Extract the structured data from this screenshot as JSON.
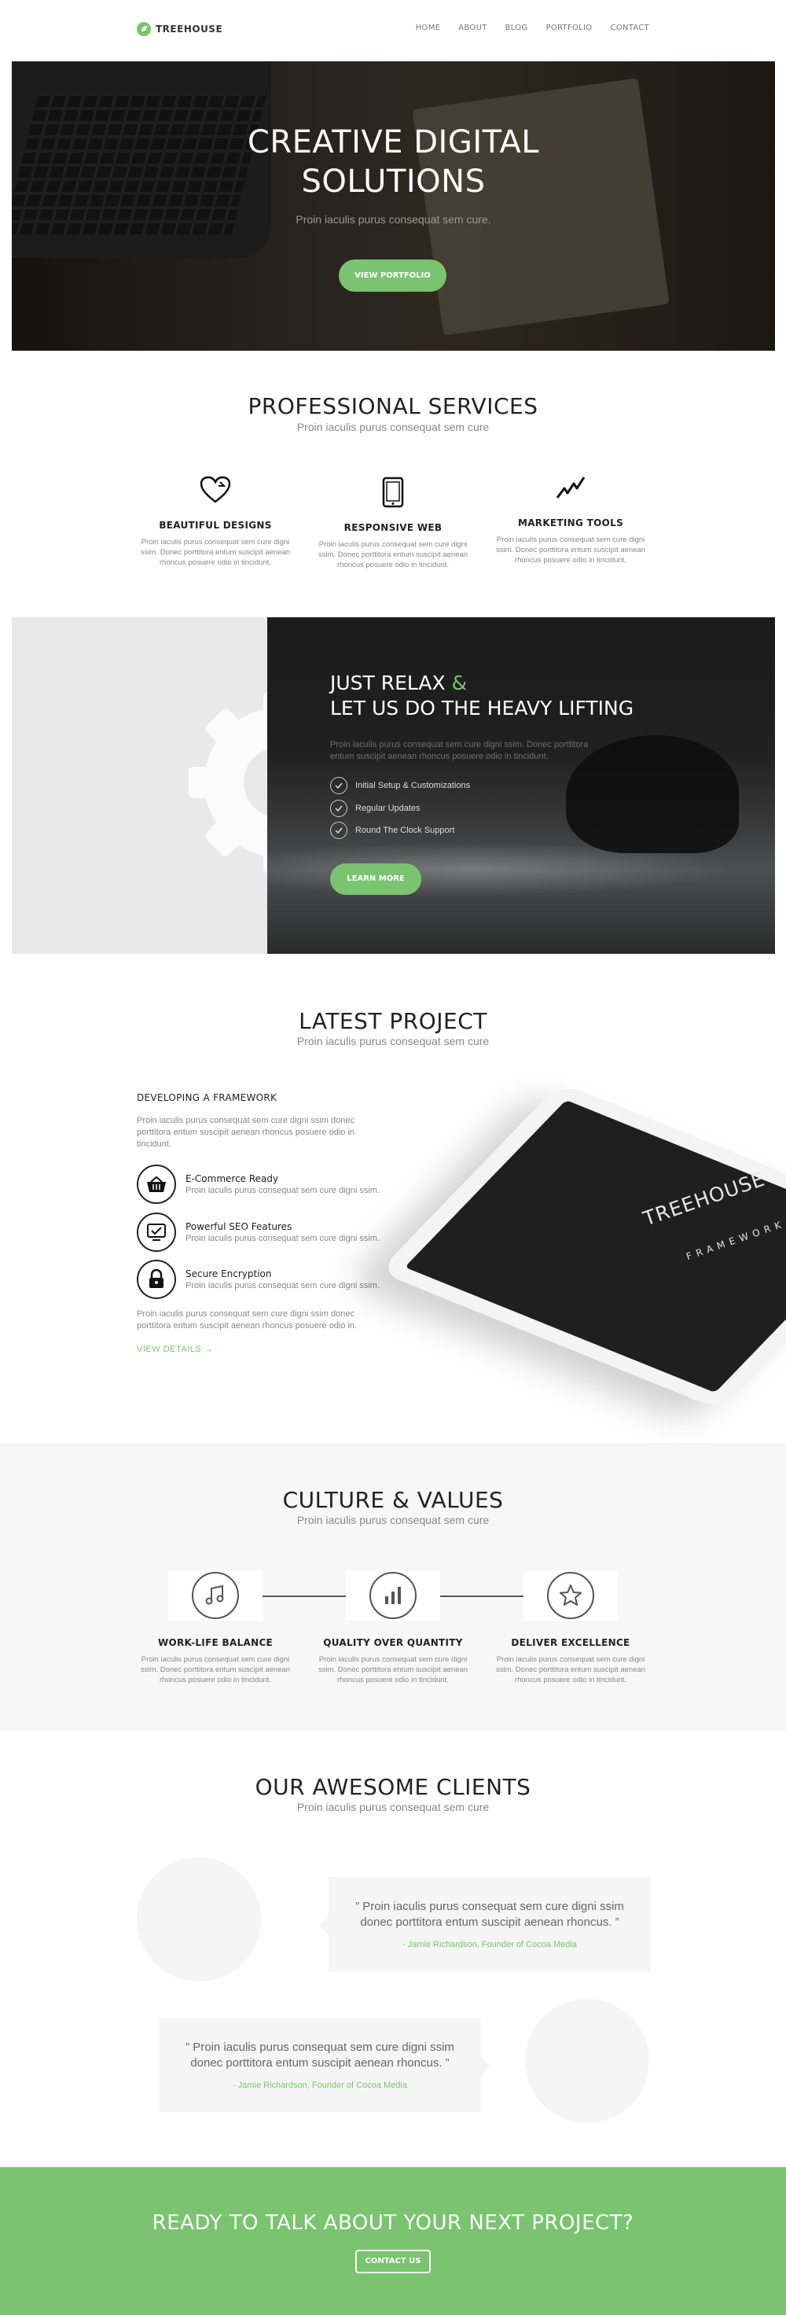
{
  "nav": {
    "logo": "TREEHOUSE",
    "items": [
      "HOME",
      "ABOUT",
      "BLOG",
      "PORTFOLIO",
      "CONTACT"
    ]
  },
  "hero": {
    "title_line1": "CREATIVE DIGITAL",
    "title_line2": "SOLUTIONS",
    "subtitle": "Proin iaculis purus consequat sem cure.",
    "button": "VIEW PORTFOLIO"
  },
  "services": {
    "title": "PROFESSIONAL SERVICES",
    "subtitle": "Proin iaculis purus consequat sem cure",
    "items": [
      {
        "title": "BEAUTIFUL DESIGNS",
        "text": "Proin iaculis purus consequat sem cure digni ssim. Donec porttitora entum suscipit aenean rhoncus posuere odio in tincidunt.",
        "icon": "heart-icon"
      },
      {
        "title": "RESPONSIVE WEB",
        "text": "Proin iaculis purus consequat sem cure digni ssim. Donec porttitora entum suscipit aenean rhoncus posuere odio in tincidunt.",
        "icon": "tablet-icon"
      },
      {
        "title": "MARKETING TOOLS",
        "text": "Proin iaculis purus consequat sem cure digni ssim. Donec porttitora entum suscipit aenean rhoncus posuere odio in tincidunt.",
        "icon": "trend-icon"
      }
    ]
  },
  "relax": {
    "title_line1_a": "JUST RELAX ",
    "title_line1_amp": "&",
    "title_line2": "LET US DO THE HEAVY LIFTING",
    "text": "Proin iaculis purus consequat sem cure digni ssim. Donec porttitora entum suscipit aenean rhoncus posuere odio in tincidunt.",
    "checks": [
      "Initial Setup & Customizations",
      "Regular Updates",
      "Round The Clock Support"
    ],
    "button": "LEARN MORE"
  },
  "project": {
    "title": "LATEST PROJECT",
    "subtitle": "Proin iaculis purus consequat sem cure",
    "heading": "DEVELOPING A FRAMEWORK",
    "intro": "Proin iaculis purus consequat sem cure digni ssim donec porttitora entum suscipit aenean rhoncus posuere odio in tincidunt.",
    "features": [
      {
        "title": "E-Commerce Ready",
        "text": "Proin iaculis purus consequat sem cure digni ssim.",
        "icon": "basket-icon"
      },
      {
        "title": "Powerful SEO Features",
        "text": "Proin iaculis purus consequat sem cure digni ssim.",
        "icon": "checked-screen-icon"
      },
      {
        "title": "Secure Encryption",
        "text": "Proin iaculis purus consequat sem cure digni ssim.",
        "icon": "lock-icon"
      }
    ],
    "outro": "Proin iaculis purus consequat sem cure digni ssim donec porttitora entum suscipit aenean rhoncus posuere odio in.",
    "link": "VIEW DETAILS →",
    "tablet_brand": "TREEHOUSE",
    "tablet_sub": "FRAMEWORK"
  },
  "culture": {
    "title": "CULTURE & VALUES",
    "subtitle": "Proin iaculis purus consequat sem cure",
    "items": [
      {
        "title": "WORK-LIFE BALANCE",
        "text": "Proin iaculis purus consequat sem cure digni ssim. Donec porttitora entum suscipit aenean rhoncus posuere odio in tincidunt.",
        "icon": "music-icon"
      },
      {
        "title": "QUALITY OVER QUANTITY",
        "text": "Proin iaculis purus consequat sem cure digni ssim. Donec porttitora entum suscipit aenean rhoncus posuere odio in tincidunt.",
        "icon": "bar-chart-icon"
      },
      {
        "title": "DELIVER EXCELLENCE",
        "text": "Proin iaculis purus consequat sem cure digni ssim. Donec porttitora entum suscipit aenean rhoncus posuere odio in tincidunt.",
        "icon": "star-icon"
      }
    ]
  },
  "clients": {
    "title": "OUR AWESOME CLIENTS",
    "subtitle": "Proin iaculis purus consequat sem cure",
    "testimonials": [
      {
        "quote_line1": "” Proin iaculis purus consequat sem cure digni ssim",
        "quote_line2": "donec porttitora entum suscipit aenean rhoncus. ”",
        "author": "- Jamie Richardson, Founder of Cocoa Media"
      },
      {
        "quote_line1": "” Proin iaculis purus consequat sem cure digni ssim",
        "quote_line2": "donec porttitora entum suscipit aenean rhoncus. ”",
        "author": "- Jamie Richardson, Founder of Cocoa Media"
      }
    ]
  },
  "cta": {
    "title": "READY TO TALK ABOUT YOUR NEXT PROJECT?",
    "button": "CONTACT US"
  },
  "colors": {
    "accent": "#7ac46f",
    "dark": "#222222",
    "muted": "#888888"
  }
}
